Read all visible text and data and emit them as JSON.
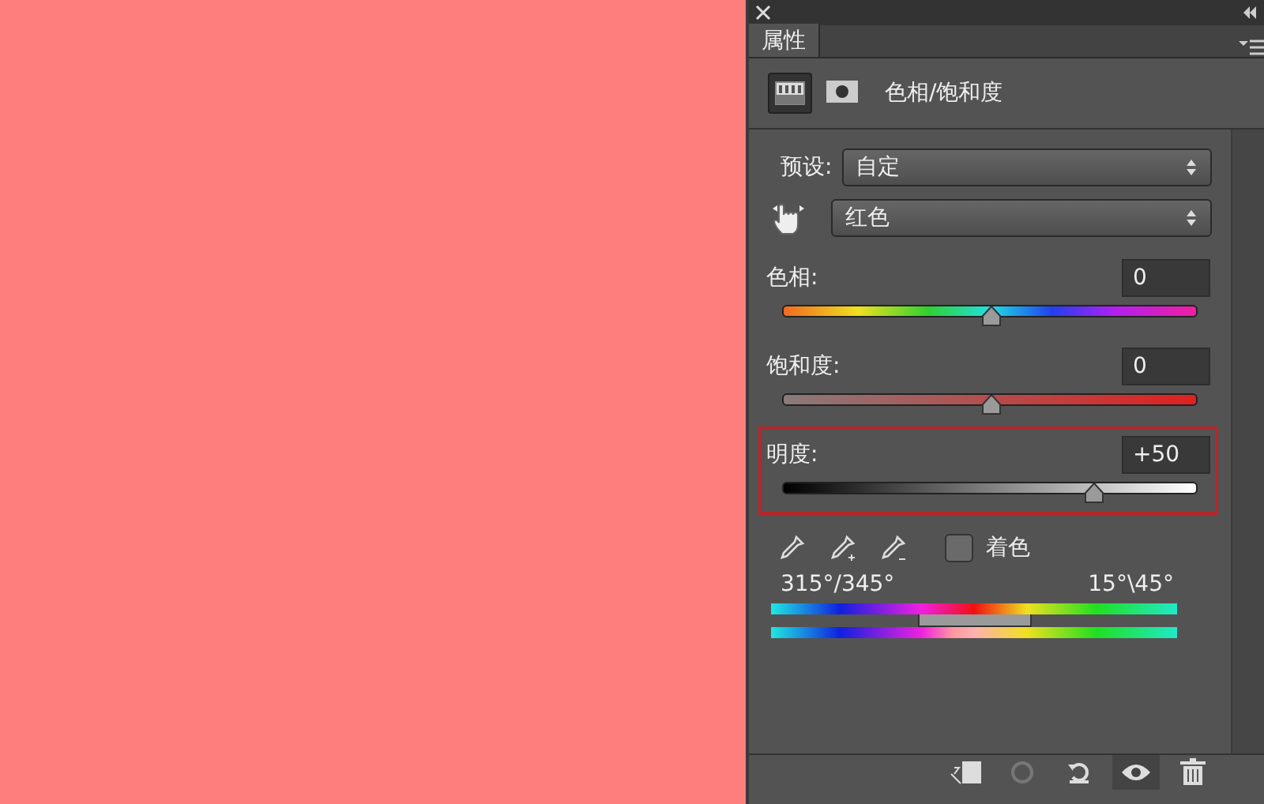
{
  "panel": {
    "tab": {
      "label": "属性",
      "selected": true
    },
    "adjustment_title": "色相/饱和度",
    "header_icons": [
      {
        "kind": "adjustment",
        "selected": true
      },
      {
        "kind": "mask",
        "selected": false
      }
    ]
  },
  "preset": {
    "label": "预设:",
    "value": "自定"
  },
  "channel": {
    "value": "红色"
  },
  "sliders": [
    {
      "kind": "hue",
      "label": "色相:",
      "value": "0",
      "level": 0.5,
      "highlighted": false
    },
    {
      "kind": "saturation",
      "label": "饱和度:",
      "value": "0",
      "level": 0.5,
      "highlighted": false
    },
    {
      "kind": "lightness",
      "label": "明度:",
      "value": "+50",
      "level": 0.75,
      "highlighted": true
    }
  ],
  "colorize": {
    "label": "着色",
    "checked": false
  },
  "range": {
    "left_label": "315°/345°",
    "right_label": "15°\\45°"
  },
  "footer": {
    "visibility_on": true
  }
}
